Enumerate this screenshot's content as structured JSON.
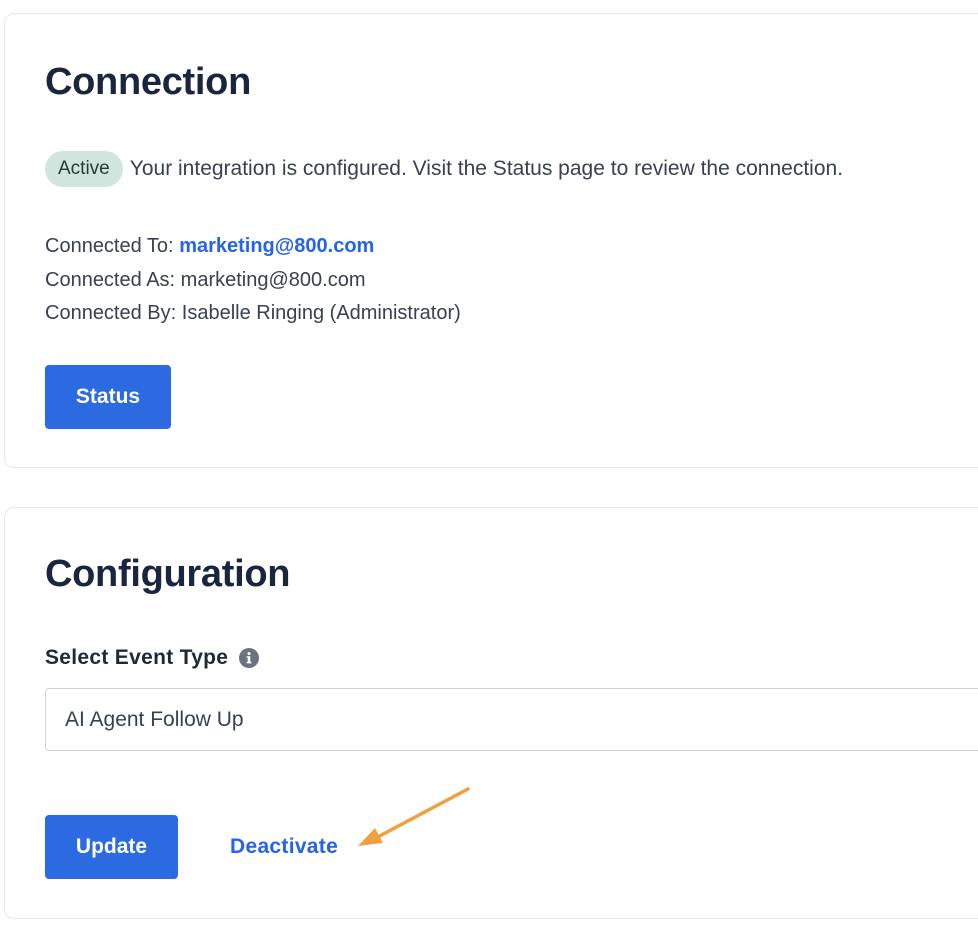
{
  "connection": {
    "title": "Connection",
    "badge": "Active",
    "status_message": "Your integration is configured. Visit the Status page to review the connection.",
    "connected_to_label": "Connected To:",
    "connected_to_value": "marketing@800.com",
    "connected_as_label": "Connected As:",
    "connected_as_value": "marketing@800.com",
    "connected_by_label": "Connected By:",
    "connected_by_value": "Isabelle Ringing (Administrator)",
    "status_button": "Status"
  },
  "configuration": {
    "title": "Configuration",
    "event_type_label": "Select Event Type",
    "event_type_value": "AI Agent Follow Up",
    "update_button": "Update",
    "deactivate_link": "Deactivate"
  },
  "icons": {
    "info": "info-circle-icon",
    "annotation": "arrow-annotation-icon"
  },
  "colors": {
    "accent": "#2b6ae0",
    "link": "#2563eb",
    "badge_bg": "#cfe5dd",
    "annotation_arrow": "#f0a040"
  }
}
